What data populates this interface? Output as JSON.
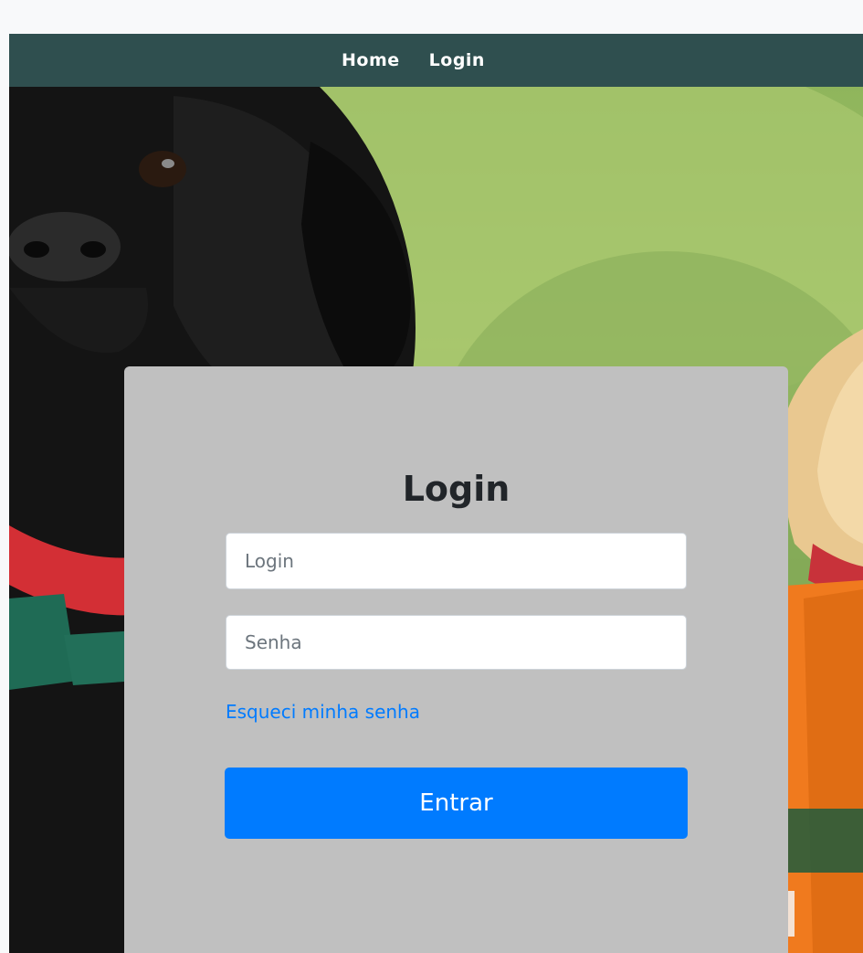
{
  "navbar": {
    "links": [
      {
        "label": "Home"
      },
      {
        "label": "Login"
      }
    ]
  },
  "login_form": {
    "title": "Login",
    "login_placeholder": "Login",
    "password_placeholder": "Senha",
    "forgot_password_label": "Esqueci minha senha",
    "submit_label": "Entrar"
  },
  "colors": {
    "navbar_bg": "#2f4f4f",
    "card_bg": "#c0c0c0",
    "primary": "#007bff"
  }
}
